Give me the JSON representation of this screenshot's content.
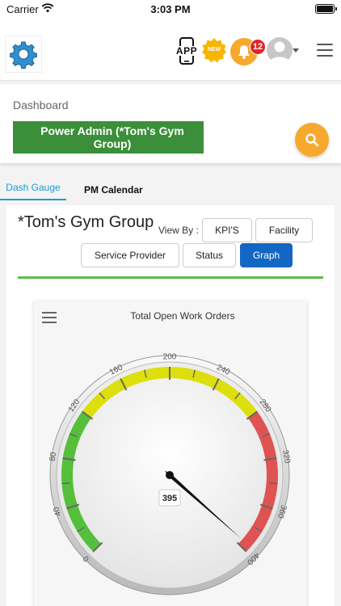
{
  "status_bar": {
    "carrier": "Carrier",
    "time": "3:03 PM"
  },
  "header": {
    "app_label": "APP",
    "new_label": "NEW",
    "notification_count": "12"
  },
  "dashboard": {
    "label": "Dashboard",
    "org_name": "Power Admin (*Tom's Gym Group)"
  },
  "tabs": [
    {
      "label": "Dash Gauge",
      "active": true
    },
    {
      "label": "PM Calendar",
      "active": false
    }
  ],
  "content": {
    "group_title": "*Tom's Gym Group",
    "view_by_label": "View By :",
    "buttons": [
      {
        "label": "KPI'S",
        "active": false
      },
      {
        "label": "Facility",
        "active": false
      },
      {
        "label": "Service Provider",
        "active": false
      },
      {
        "label": "Status",
        "active": false
      },
      {
        "label": "Graph",
        "active": true
      }
    ]
  },
  "chart_data": {
    "type": "gauge",
    "title": "Total Open Work Orders",
    "min": 0,
    "max": 400,
    "value": 395,
    "value_label": "395",
    "tick_labels": [
      "0",
      "40",
      "80",
      "120",
      "160",
      "200",
      "240",
      "280",
      "320",
      "360",
      "400"
    ],
    "bands": [
      {
        "from": 0,
        "to": 120,
        "color": "#55bf3b"
      },
      {
        "from": 120,
        "to": 280,
        "color": "#dddf0d"
      },
      {
        "from": 280,
        "to": 400,
        "color": "#df5353"
      }
    ]
  },
  "colors": {
    "accent_blue": "#1266c4",
    "tab_blue": "#1a9bd7",
    "org_green": "#3c8f3a",
    "action_orange": "#f6a92c",
    "badge_red": "#e02424"
  }
}
